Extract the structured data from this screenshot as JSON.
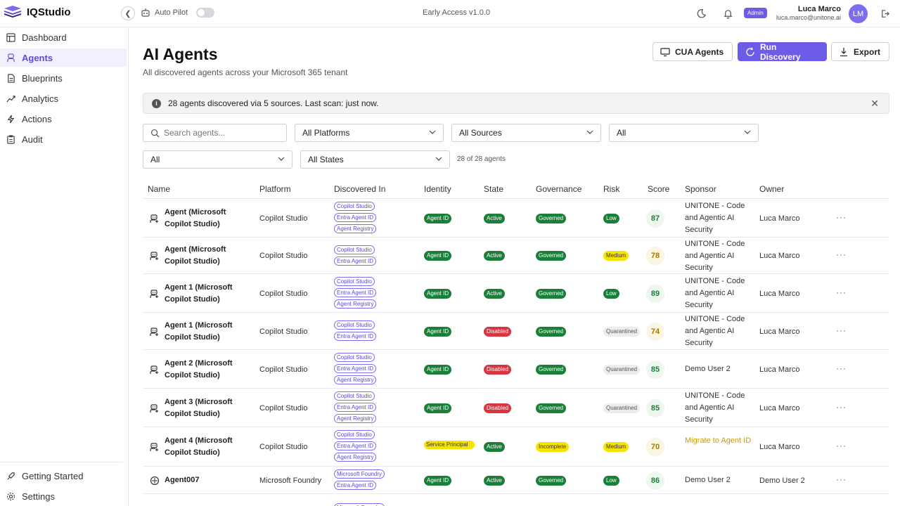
{
  "app": {
    "name": "IQStudio",
    "autopilot_label": "Auto Pilot",
    "version": "Early Access v1.0.0",
    "admin_badge": "Admin",
    "user_name": "Luca Marco",
    "user_email": "luca.marco@unitone.ai",
    "user_initials": "LM",
    "accent": "#6c5ce7"
  },
  "sidebar": {
    "items": [
      {
        "label": "Dashboard",
        "icon": "dashboard-icon"
      },
      {
        "label": "Agents",
        "icon": "agents-icon"
      },
      {
        "label": "Blueprints",
        "icon": "blueprints-icon"
      },
      {
        "label": "Analytics",
        "icon": "analytics-icon"
      },
      {
        "label": "Actions",
        "icon": "actions-icon"
      },
      {
        "label": "Audit",
        "icon": "audit-icon"
      }
    ],
    "bottom": [
      {
        "label": "Getting Started",
        "icon": "getting-started-icon"
      },
      {
        "label": "Settings",
        "icon": "gear-icon"
      }
    ]
  },
  "header": {
    "title": "AI Agents",
    "subtitle": "All discovered agents across your Microsoft 365 tenant",
    "cua_label": "CUA Agents",
    "run_label": "Run Discovery",
    "export_label": "Export"
  },
  "banner": {
    "text": "28 agents discovered via 5 sources. Last scan: just now."
  },
  "filters": {
    "search_placeholder": "Search agents...",
    "platforms": "All Platforms",
    "sources": "All Sources",
    "filter3": "All",
    "filter4": "All",
    "states": "All States",
    "count": "28 of 28 agents"
  },
  "table": {
    "headers": {
      "name": "Name",
      "platform": "Platform",
      "discovered": "Discovered In",
      "identity": "Identity",
      "state": "State",
      "governance": "Governance",
      "risk": "Risk",
      "score": "Score",
      "sponsor": "Sponsor",
      "owner": "Owner"
    },
    "rows": [
      {
        "name": "Agent (Microsoft Copilot Studio)",
        "platform": "Copilot Studio",
        "discovered": [
          "Copilot Studio",
          "Entra Agent ID",
          "Agent Registry"
        ],
        "identity": "Agent ID",
        "state": "Active",
        "governance": "Governed",
        "risk": "Low",
        "score": "87",
        "sponsor": "UNITONE - Code and Agentic AI Security",
        "owner": "Luca Marco"
      },
      {
        "name": "Agent (Microsoft Copilot Studio)",
        "platform": "Copilot Studio",
        "discovered": [
          "Copilot Studio",
          "Entra Agent ID"
        ],
        "identity": "Agent ID",
        "state": "Active",
        "governance": "Governed",
        "risk": "Medium",
        "score": "78",
        "sponsor": "UNITONE - Code and Agentic AI Security",
        "owner": "Luca Marco"
      },
      {
        "name": "Agent 1 (Microsoft Copilot Studio)",
        "platform": "Copilot Studio",
        "discovered": [
          "Copilot Studio",
          "Entra Agent ID",
          "Agent Registry"
        ],
        "identity": "Agent ID",
        "state": "Active",
        "governance": "Governed",
        "risk": "Low",
        "score": "89",
        "sponsor": "UNITONE - Code and Agentic AI Security",
        "owner": "Luca Marco"
      },
      {
        "name": "Agent 1 (Microsoft Copilot Studio)",
        "platform": "Copilot Studio",
        "discovered": [
          "Copilot Studio",
          "Entra Agent ID"
        ],
        "identity": "Agent ID",
        "state": "Disabled",
        "governance": "Governed",
        "risk": "Quarantined",
        "score": "74",
        "sponsor": "UNITONE - Code and Agentic AI Security",
        "owner": "Luca Marco"
      },
      {
        "name": "Agent 2 (Microsoft Copilot Studio)",
        "platform": "Copilot Studio",
        "discovered": [
          "Copilot Studio",
          "Entra Agent ID",
          "Agent Registry"
        ],
        "identity": "Agent ID",
        "state": "Disabled",
        "governance": "Governed",
        "risk": "Quarantined",
        "score": "85",
        "sponsor": "Demo User 2",
        "owner": "Luca Marco"
      },
      {
        "name": "Agent 3 (Microsoft Copilot Studio)",
        "platform": "Copilot Studio",
        "discovered": [
          "Copilot Studio",
          "Entra Agent ID",
          "Agent Registry"
        ],
        "identity": "Agent ID",
        "state": "Disabled",
        "governance": "Governed",
        "risk": "Quarantined",
        "score": "85",
        "sponsor": "UNITONE - Code and Agentic AI Security",
        "owner": "Luca Marco"
      },
      {
        "name": "Agent 4 (Microsoft Copilot Studio)",
        "platform": "Copilot Studio",
        "discovered": [
          "Copilot Studio",
          "Entra Agent ID",
          "Agent Registry"
        ],
        "identity": "Service Principal",
        "state": "Active",
        "governance": "Incomplete",
        "risk": "Medium",
        "score": "70",
        "sponsor": "Migrate to Agent ID",
        "owner": "Luca Marco"
      },
      {
        "name": "Agent007",
        "platform": "Microsoft Foundry",
        "discovered": [
          "Microsoft Foundry",
          "Entra Agent ID"
        ],
        "identity": "Agent ID",
        "state": "Active",
        "governance": "Governed",
        "risk": "Low",
        "score": "86",
        "sponsor": "Demo User 2",
        "owner": "Demo User 2"
      },
      {
        "name": "",
        "platform": "",
        "discovered": [
          "Microsoft Foundry"
        ],
        "identity": "",
        "state": "",
        "governance": "",
        "risk": "",
        "score": "",
        "sponsor": "",
        "owner": ""
      }
    ]
  }
}
